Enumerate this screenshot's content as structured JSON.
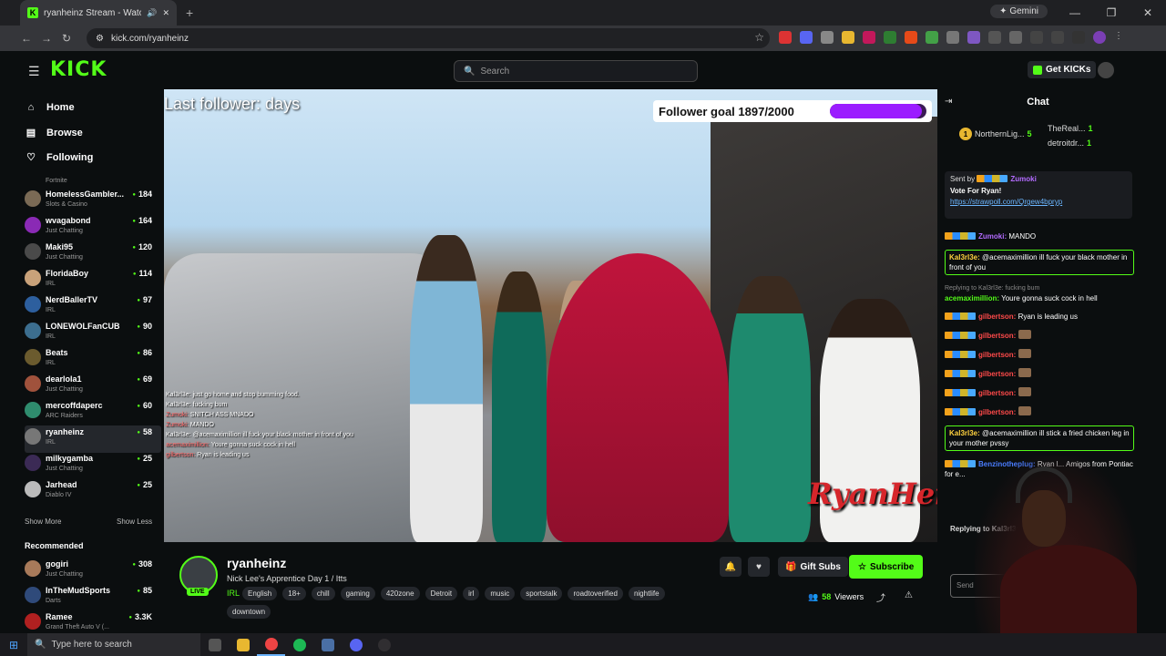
{
  "browser": {
    "tab_title": "ryanheinz Stream - Watch L",
    "new_tab": "+",
    "gemini": "Gemini",
    "url": "kick.com/ryanheinz",
    "window_controls": [
      "—",
      "❐",
      "✕"
    ]
  },
  "header": {
    "logo": "KICK",
    "search_placeholder": "Search",
    "get_kicks": "Get KICKs"
  },
  "sidebar": {
    "nav": [
      {
        "label": "Home",
        "icon": "home-icon"
      },
      {
        "label": "Browse",
        "icon": "browse-icon"
      },
      {
        "label": "Following",
        "icon": "heart-icon"
      }
    ],
    "partial_category": "Fortnite",
    "channels": [
      {
        "name": "HomelessGambler...",
        "category": "Slots & Casino",
        "viewers": "184",
        "color": "#7a6a55"
      },
      {
        "name": "wvagabond",
        "category": "Just Chatting",
        "viewers": "164",
        "color": "#8a2ab5"
      },
      {
        "name": "Maki95",
        "category": "Just Chatting",
        "viewers": "120",
        "color": "#4a4a4a"
      },
      {
        "name": "FloridaBoy",
        "category": "IRL",
        "viewers": "114",
        "color": "#c9a27a"
      },
      {
        "name": "NerdBallerTV",
        "category": "IRL",
        "viewers": "97",
        "color": "#2d5f9e"
      },
      {
        "name": "LONEWOLFanCUB",
        "category": "IRL",
        "viewers": "90",
        "color": "#3c6e8f"
      },
      {
        "name": "Beats",
        "category": "IRL",
        "viewers": "86",
        "color": "#6b5b2e"
      },
      {
        "name": "dearlola1",
        "category": "Just Chatting",
        "viewers": "69",
        "color": "#a0523c"
      },
      {
        "name": "mercoffdaperc",
        "category": "ARC Raiders",
        "viewers": "60",
        "color": "#2f8c6e"
      },
      {
        "name": "ryanheinz",
        "category": "IRL",
        "viewers": "58",
        "color": "#777777"
      },
      {
        "name": "milkygamba",
        "category": "Just Chatting",
        "viewers": "25",
        "color": "#3b2a55"
      },
      {
        "name": "Jarhead",
        "category": "Diablo IV",
        "viewers": "25",
        "color": "#bbbbbb"
      }
    ],
    "show_more": "Show More",
    "show_less": "Show Less",
    "recommended_title": "Recommended",
    "recommended": [
      {
        "name": "gogiri",
        "category": "Just Chatting",
        "viewers": "308",
        "color": "#a87a5a"
      },
      {
        "name": "InTheMudSports",
        "category": "Darts",
        "viewers": "85",
        "color": "#2f4a7a"
      },
      {
        "name": "Ramee",
        "category": "Grand Theft Auto V (...",
        "viewers": "3.3K",
        "color": "#b02020"
      }
    ]
  },
  "video": {
    "last_follower": "Last follower: days",
    "follower_goal": "Follower goal 1897/2000",
    "goal_progress": 0.9485,
    "brand_overlay": "RyanHeinz",
    "overlay_chat": [
      {
        "user": "",
        "text": "Kal3rl3e: just go home and stop bumming food."
      },
      {
        "user": "",
        "text": "Kal3rl3e: fucking bum"
      },
      {
        "user": "Zumoki:",
        "text": "SNITCH ASS MNADO"
      },
      {
        "user": "Zumoki:",
        "text": "MANDO"
      },
      {
        "user": "",
        "text": "Kal3rl3e: @acemaximillion ill fuck your black mother in front of you"
      },
      {
        "user": "acemaximillion:",
        "text": "Youre gonna suck cock in hell"
      },
      {
        "user": "gilbertson:",
        "text": "Ryan is leading us"
      }
    ]
  },
  "stream": {
    "name": "ryanheinz",
    "live": "LIVE",
    "title": "Nick Lee's Apprentice Day 1 / Itts",
    "category": "IRL",
    "tags": [
      "English",
      "18+",
      "chill",
      "gaming",
      "420zone",
      "Detroit",
      "irl",
      "music",
      "sportstalk",
      "roadtoverified",
      "nightlife"
    ],
    "tag_overflow": "downtown",
    "gift_subs": "Gift Subs",
    "subscribe": "Subscribe",
    "viewers": "58",
    "viewers_label": "Viewers"
  },
  "chat": {
    "title": "Chat",
    "gifters": [
      {
        "rank": "1",
        "name": "NorthernLig...",
        "count": "5"
      },
      {
        "rank": "",
        "name": "TheReal...",
        "count": "1"
      },
      {
        "rank": "",
        "name": "detroitdr...",
        "count": "1"
      }
    ],
    "pinned": {
      "sent_by": "Sent by",
      "sender": "Zumoki",
      "message": "Vote For Ryan!",
      "link": "https://strawpoll.com/Qrgew4bpryp"
    },
    "messages": [
      {
        "user": "Zumoki:",
        "text": "MANDO",
        "color": "#b36bff",
        "badges": true,
        "highlight": false,
        "reply": ""
      },
      {
        "user": "Kal3rl3e:",
        "text": "@acemaximillion ill fuck your black mother in front of you",
        "color": "#ffd23f",
        "badges": false,
        "highlight": true,
        "reply": ""
      },
      {
        "user": "acemaximillion:",
        "text": "Youre gonna suck cock in hell",
        "color": "#53fc18",
        "badges": false,
        "highlight": false,
        "reply": "Replying to Kal3rl3e: fucking bum"
      },
      {
        "user": "gilbertson:",
        "text": "Ryan is leading us",
        "color": "#ff4a4a",
        "badges": true,
        "highlight": false,
        "reply": ""
      },
      {
        "user": "gilbertson:",
        "text": "",
        "color": "#ff4a4a",
        "badges": true,
        "highlight": false,
        "reply": ""
      },
      {
        "user": "gilbertson:",
        "text": "",
        "color": "#ff4a4a",
        "badges": true,
        "highlight": false,
        "reply": ""
      },
      {
        "user": "gilbertson:",
        "text": "",
        "color": "#ff4a4a",
        "badges": true,
        "highlight": false,
        "reply": ""
      },
      {
        "user": "gilbertson:",
        "text": "",
        "color": "#ff4a4a",
        "badges": true,
        "highlight": false,
        "reply": ""
      },
      {
        "user": "gilbertson:",
        "text": "",
        "color": "#ff4a4a",
        "badges": true,
        "highlight": false,
        "reply": ""
      },
      {
        "user": "Kal3rl3e:",
        "text": "@acemaximillion ill stick a fried chicken leg in your mother pvssy",
        "color": "#ffd23f",
        "badges": false,
        "highlight": true,
        "reply": ""
      },
      {
        "user": "Benzinotheplug:",
        "text": "Ryan l... Amigos from Pontiac for e...",
        "color": "#4a7dff",
        "badges": true,
        "highlight": false,
        "reply": ""
      }
    ],
    "replying_to": "Replying to Kal3rl3e",
    "input_placeholder": "Send"
  },
  "taskbar": {
    "search_placeholder": "Type here to search"
  }
}
